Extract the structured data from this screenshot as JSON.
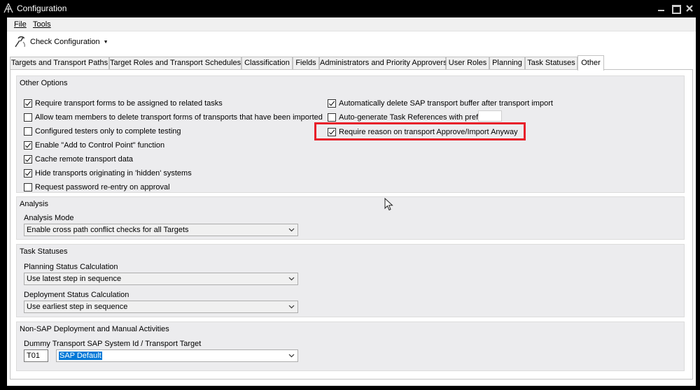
{
  "window": {
    "title": "Configuration"
  },
  "menu": {
    "file": "File",
    "tools": "Tools"
  },
  "toolbar": {
    "check_configuration": "Check Configuration"
  },
  "tabs": [
    {
      "label": "Targets and Transport Paths"
    },
    {
      "label": "Target Roles and Transport Schedules"
    },
    {
      "label": "Classification"
    },
    {
      "label": "Fields"
    },
    {
      "label": "Administrators and Priority Approvers"
    },
    {
      "label": "User Roles"
    },
    {
      "label": "Planning"
    },
    {
      "label": "Task Statuses"
    },
    {
      "label": "Other"
    }
  ],
  "other_options": {
    "title": "Other Options",
    "left": [
      {
        "label": "Require transport forms to be assigned to related tasks",
        "checked": true
      },
      {
        "label": "Allow team members to delete transport forms of transports that have been imported",
        "checked": false
      },
      {
        "label": "Configured testers only to complete testing",
        "checked": false
      },
      {
        "label": "Enable \"Add to Control Point\" function",
        "checked": true
      },
      {
        "label": "Cache remote transport data",
        "checked": true
      },
      {
        "label": "Hide transports originating in 'hidden' systems",
        "checked": true
      },
      {
        "label": "Request password re-entry on approval",
        "checked": false
      }
    ],
    "right": [
      {
        "label": "Automatically delete SAP transport buffer after transport import",
        "checked": true
      },
      {
        "label": "Auto-generate Task References with prefix:",
        "checked": false
      },
      {
        "label": "Require reason on transport Approve/Import Anyway",
        "checked": true
      }
    ],
    "prefix_value": ""
  },
  "analysis": {
    "title": "Analysis",
    "mode_label": "Analysis Mode",
    "mode_value": "Enable cross path conflict checks for all Targets"
  },
  "task_statuses": {
    "title": "Task Statuses",
    "planning_label": "Planning Status Calculation",
    "planning_value": "Use latest step in sequence",
    "deployment_label": "Deployment Status Calculation",
    "deployment_value": "Use earliest step in sequence"
  },
  "non_sap": {
    "title": "Non-SAP Deployment and Manual Activities",
    "dummy_label": "Dummy Transport SAP System Id / Transport Target",
    "system_id": "T01",
    "target_value": "SAP Default"
  },
  "colors": {
    "highlight": "#e8202a",
    "selection": "#0078d7"
  }
}
